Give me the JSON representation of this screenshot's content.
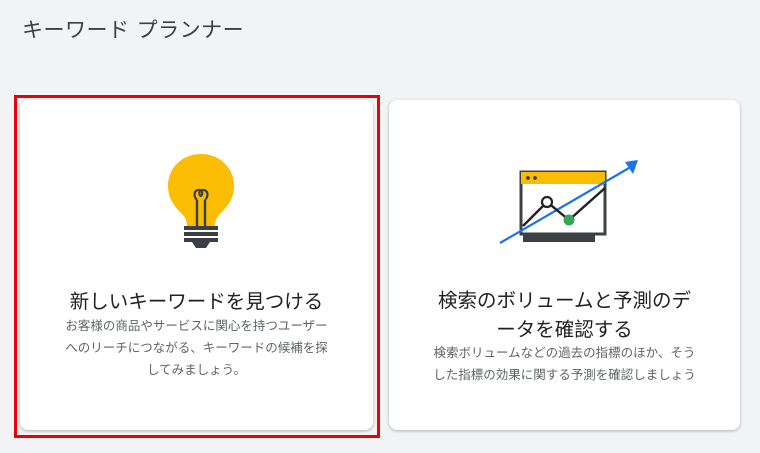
{
  "header": {
    "title": "キーワード プランナー"
  },
  "cards": [
    {
      "icon": "lightbulb-icon",
      "title": "新しいキーワードを見つける",
      "description_lines": [
        "お客様の商品やサービスに関心を持つユーザー",
        "へのリーチにつながる、キーワードの候補を探",
        "してみましょう。"
      ],
      "selected": true
    },
    {
      "icon": "forecast-chart-icon",
      "title_lines": [
        "検索のボリュームと予測のデ",
        "ータを確認する"
      ],
      "description_lines": [
        "検索ボリュームなどの過去の指標のほか、そう",
        "した指標の効果に関する予測を確認しましょう"
      ],
      "selected": false
    }
  ],
  "colors": {
    "background": "#f1f3f4",
    "card": "#ffffff",
    "selection_border": "#e8000b",
    "bulb_yellow": "#fbbc04",
    "chart_blue": "#1a73e8",
    "chart_green": "#34a853"
  }
}
